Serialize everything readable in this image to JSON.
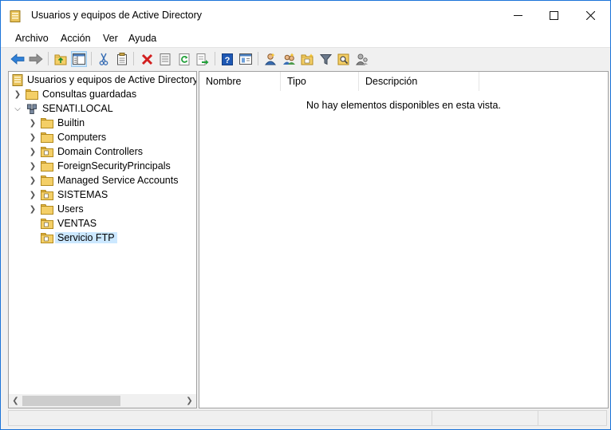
{
  "window": {
    "title": "Usuarios y equipos de Active Directory",
    "minimize_glyph": "—",
    "maximize_glyph": "☐",
    "close_glyph": "✕"
  },
  "menu": {
    "items": [
      "Archivo",
      "Acción",
      "Ver",
      "Ayuda"
    ]
  },
  "toolbar": {
    "icons": [
      "back-icon",
      "forward-icon",
      "up-folder-icon",
      "show-hide-tree-icon",
      "cut-icon",
      "copy-icon",
      "delete-icon",
      "properties-icon",
      "refresh-icon",
      "export-list-icon",
      "help-icon",
      "console-view-icon",
      "new-user-icon",
      "new-group-icon",
      "new-ou-icon",
      "filter-icon",
      "find-icon",
      "delegate-icon"
    ]
  },
  "tree": {
    "root": "Usuarios y equipos de Active Directory [",
    "saved_queries": "Consultas guardadas",
    "domain": "SENATI.LOCAL",
    "children": [
      {
        "label": "Builtin",
        "expandable": true,
        "ou": false
      },
      {
        "label": "Computers",
        "expandable": true,
        "ou": false
      },
      {
        "label": "Domain Controllers",
        "expandable": true,
        "ou": true
      },
      {
        "label": "ForeignSecurityPrincipals",
        "expandable": true,
        "ou": false
      },
      {
        "label": "Managed Service Accounts",
        "expandable": true,
        "ou": false
      },
      {
        "label": "SISTEMAS",
        "expandable": true,
        "ou": true
      },
      {
        "label": "Users",
        "expandable": true,
        "ou": false
      },
      {
        "label": "VENTAS",
        "expandable": false,
        "ou": true
      },
      {
        "label": "Servicio FTP",
        "expandable": false,
        "ou": true,
        "selected": true
      }
    ]
  },
  "list": {
    "columns": [
      "Nombre",
      "Tipo",
      "Descripción"
    ],
    "empty_message": "No hay elementos disponibles en esta vista."
  },
  "colors": {
    "window_border": "#1a73d9",
    "selection": "#cce8ff",
    "folder": "#f4cf67"
  }
}
